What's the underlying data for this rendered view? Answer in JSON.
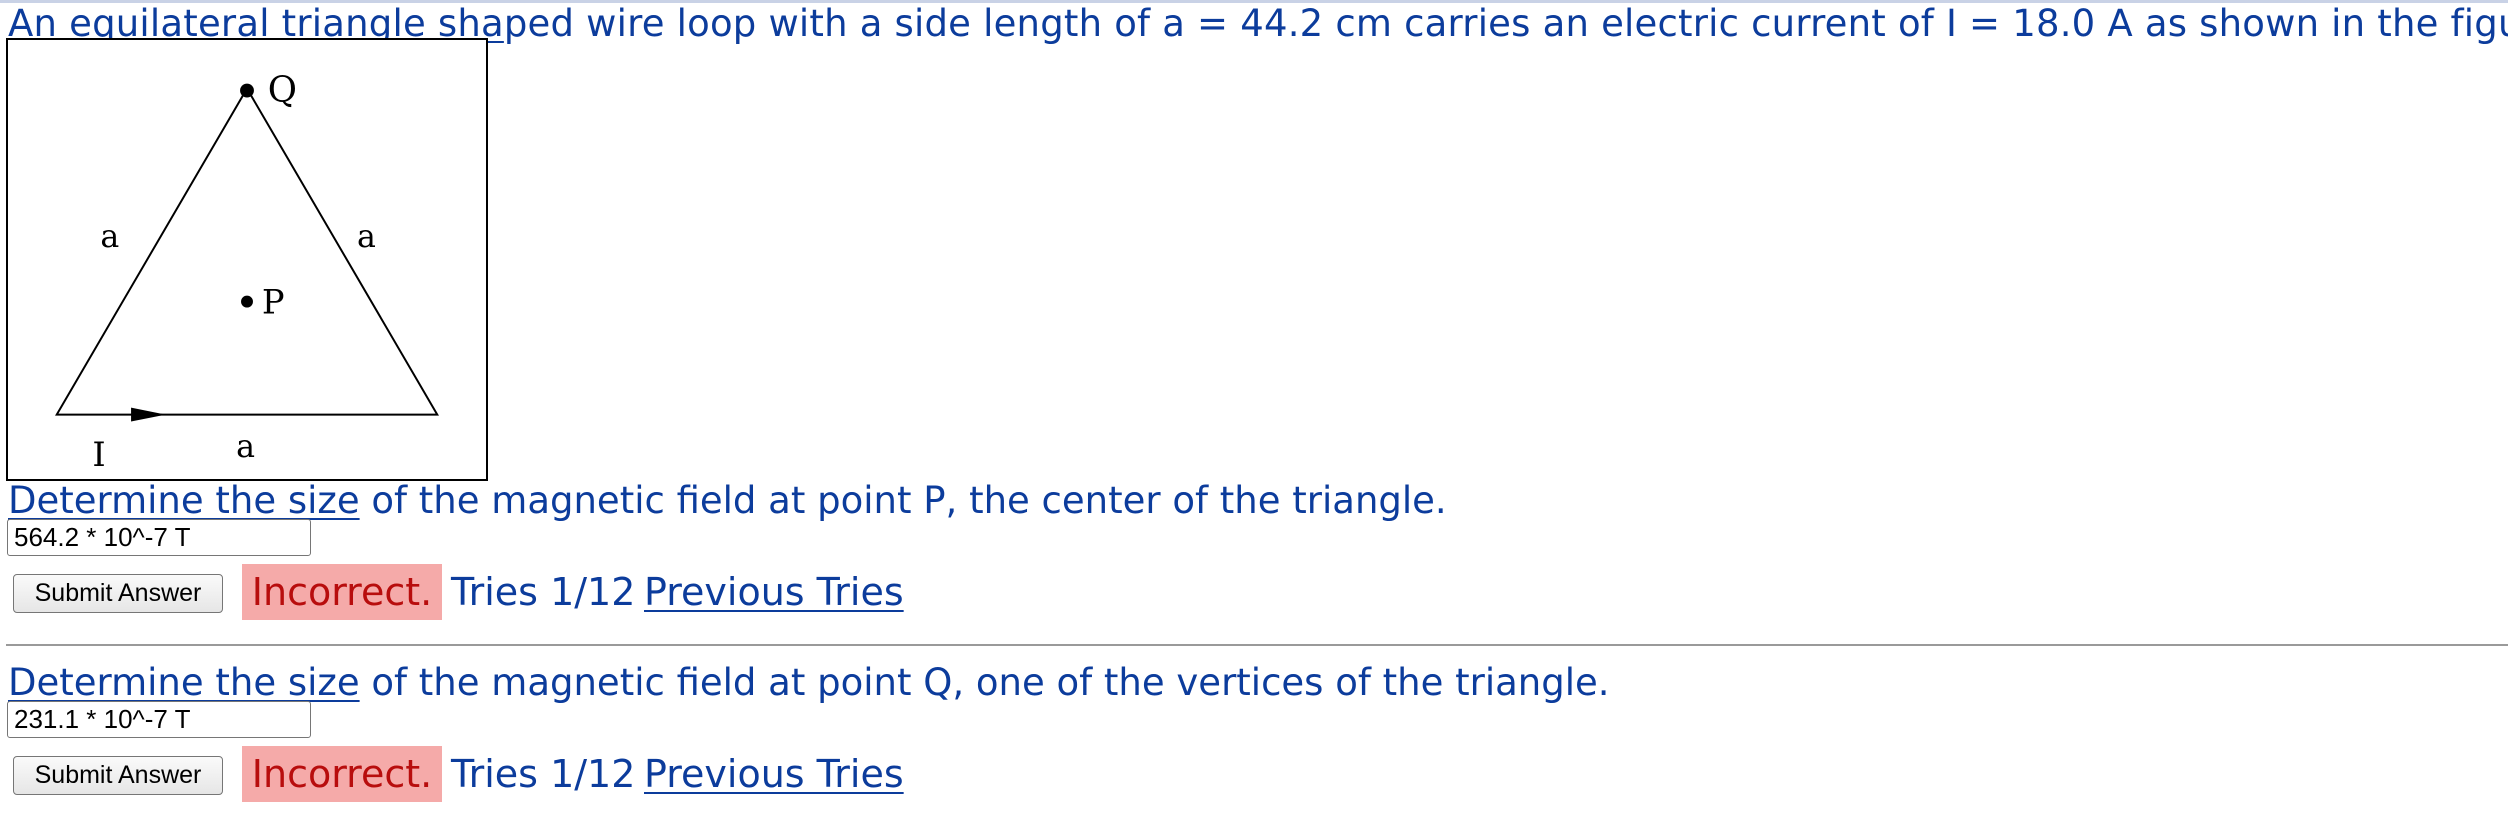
{
  "problem": {
    "statement_linked": "An equilateral triangle sha",
    "statement_rest": "ped wire loop with a side length of a = 44.2 cm carries an electric current of I = 18.0 A as shown in the figure."
  },
  "figure": {
    "label_q": "Q",
    "label_p": "P",
    "label_i": "I",
    "label_side_left": "a",
    "label_side_right": "a",
    "label_side_bottom": "a"
  },
  "parts": [
    {
      "question_linked": "Determine the size",
      "question_rest": " of the magnetic field at point P, the center of the triangle.",
      "answer_value": "564.2 * 10^-7 T",
      "submit_label": "Submit Answer",
      "status": "Incorrect.",
      "tries": "Tries 1/12",
      "previous_tries_label": "Previous Tries"
    },
    {
      "question_linked": "Determine the size",
      "question_rest": " of the magnetic field at point Q, one of the vertices of the triangle.",
      "answer_value": "231.1 * 10^-7 T",
      "submit_label": "Submit Answer",
      "status": "Incorrect.",
      "tries": "Tries 1/12",
      "previous_tries_label": "Previous Tries"
    }
  ],
  "colors": {
    "text_blue": "#0c3c9c",
    "incorrect_bg": "#f5aaa9",
    "incorrect_text": "#b80d0d"
  }
}
